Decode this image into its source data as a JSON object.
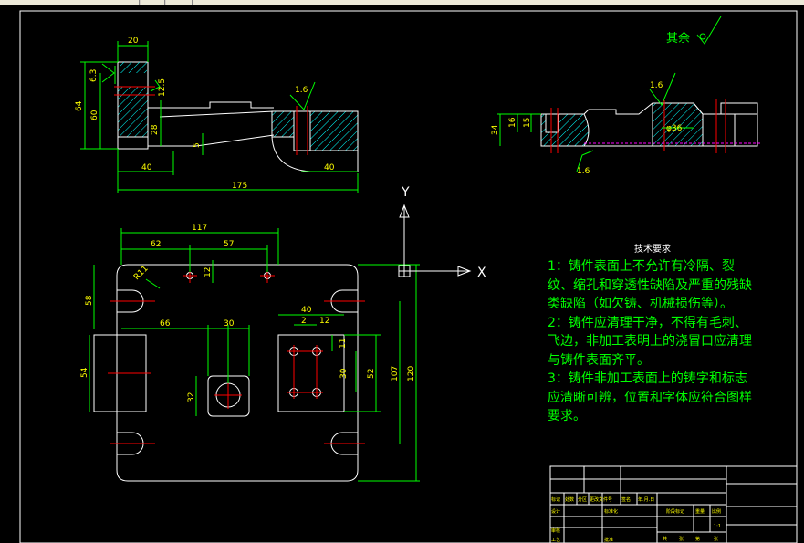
{
  "roughness": {
    "label": "其余",
    "value_top": "1.6",
    "value_top2": "1.6",
    "value_bottom": "1.6"
  },
  "dimensions": {
    "d20": "20",
    "d6_3": "6.3",
    "d12_5": "12.5",
    "d64": "64",
    "d60": "60",
    "d28": "28",
    "d5": "5",
    "d40a": "40",
    "d40b": "40",
    "d175": "175",
    "d117": "117",
    "d62": "62",
    "d57": "57",
    "d12": "12",
    "r11": "R11",
    "d58": "58",
    "d54": "54",
    "d66": "66",
    "d30": "30",
    "d32": "32",
    "d40c": "40",
    "d2": "2",
    "d12b": "12",
    "d11": "11",
    "d30b": "30",
    "d52": "52",
    "d107": "107",
    "d120": "120",
    "d34": "34",
    "d16": "16",
    "d15": "15",
    "phi36": "φ36"
  },
  "axes": {
    "x": "X",
    "y": "Y"
  },
  "notes": {
    "title": "技术要求",
    "lines": [
      "1：铸件表面上不允许有冷隔、裂",
      "纹、缩孔和穿透性缺陷及严重的残缺",
      "类缺陷（如欠铸、机械损伤等）。",
      "2：铸件应清理干净，不得有毛刺、",
      "飞边，非加工表明上的浇冒口应清理",
      "与铸件表面齐平。",
      "3：铸件非加工表面上的铸字和标志",
      "应清晰可辨，位置和字体应符合图样",
      "要求。"
    ]
  },
  "title_block": {
    "row_a": [
      "标记",
      "处数",
      "分区",
      "更改文件号",
      "签名",
      "年.月.日"
    ],
    "row_b": [
      "设计",
      "",
      "标准化"
    ],
    "stage": "阶段标记",
    "weight": "重量",
    "scale": "比例",
    "scale_value": "1:1",
    "review": "审核",
    "craft": "工艺",
    "approve": "批准",
    "sheets_total": "共",
    "sheets_label": "张",
    "sheet_no": "第",
    "sheet_label": "张"
  },
  "colors": {
    "outline": "#ffffff",
    "dimension": "#00ff00",
    "center": "#ff0000",
    "hatch": "#00ffff",
    "hidden": "#ff00ff",
    "text_yellow": "#ffff00",
    "note_green": "#00ff00"
  }
}
